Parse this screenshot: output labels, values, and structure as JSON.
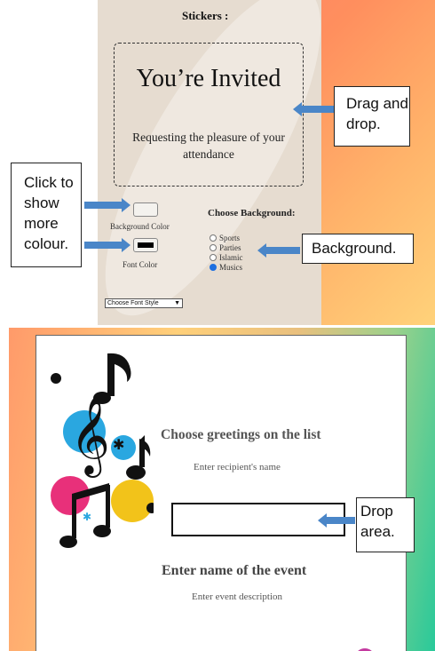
{
  "editor": {
    "stickers_label": "Stickers :",
    "invite_title": "You’re Invited",
    "invite_subtitle": "Requesting the pleasure of your attendance",
    "bg_color_label": "Background Color",
    "font_color_label": "Font Color",
    "choose_bg_label": "Choose Background:",
    "bg_options": [
      {
        "label": "Sports",
        "checked": false
      },
      {
        "label": "Parties",
        "checked": false
      },
      {
        "label": "Islamic",
        "checked": false
      },
      {
        "label": "Musics",
        "checked": true
      }
    ],
    "font_style_select": "Choose Font Style"
  },
  "callouts": {
    "drag_drop": "Drag and drop.",
    "click_colour": "Click to show more colour.",
    "background": "Background.",
    "drop_area": "Drop area."
  },
  "card": {
    "greetings_title": "Choose greetings on the list",
    "recipient_placeholder": "Enter recipient's name",
    "event_title": "Enter name of the event",
    "event_desc_placeholder": "Enter event description"
  },
  "colors": {
    "arrow": "#4a86c8",
    "selected_radio": "#1e6fe0",
    "beige": "#e6dcd0"
  },
  "icons": [
    "music-notes-icon",
    "treble-clef-icon",
    "arrow-left-icon",
    "arrow-right-icon",
    "chevron-down-icon"
  ]
}
